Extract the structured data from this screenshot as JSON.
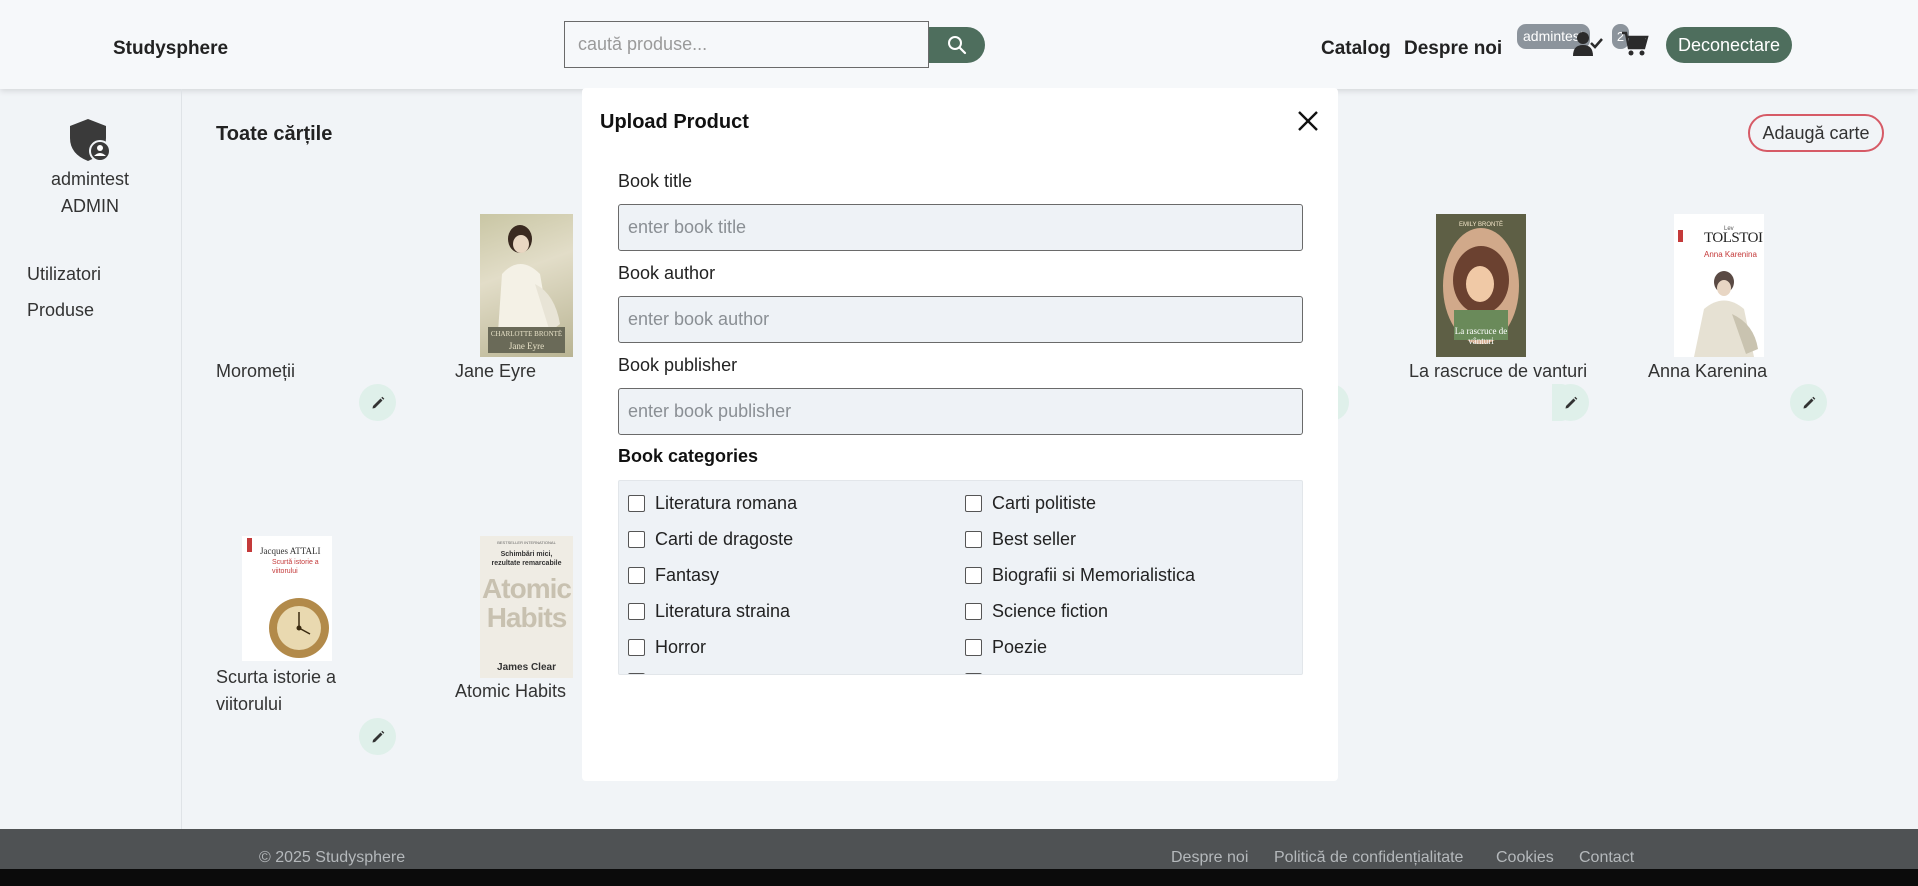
{
  "header": {
    "brand": "Studysphere",
    "search_placeholder": "caută produse...",
    "nav": {
      "catalog": "Catalog",
      "about": "Despre noi"
    },
    "user_badge": "admintest",
    "cart_count": "2",
    "logout": "Deconectare"
  },
  "sidebar": {
    "admin_name": "admintest",
    "admin_role": "ADMIN",
    "links": [
      "Utilizatori",
      "Produse"
    ]
  },
  "main": {
    "title": "Toate cărțile",
    "add_button": "Adaugă carte",
    "books": [
      {
        "title": "Moromeții"
      },
      {
        "title": "Jane Eyre"
      },
      {
        "title": "La rascruce de vanturi"
      },
      {
        "title": "Anna Karenina"
      },
      {
        "title": "Scurta istorie a viitorului"
      },
      {
        "title": "Atomic Habits"
      }
    ],
    "covers": {
      "jane_eyre_author": "CHARLOTTE BRONTË",
      "jane_eyre_title": "Jane Eyre",
      "rascruce_author": "EMILY BRONTË",
      "rascruce_title": "La rascruce de vânturi",
      "anna_author": "TOLSTOI",
      "anna_author_prefix": "Lev",
      "anna_title": "Anna Karenina",
      "attali_author": "Jacques ATTALI",
      "attali_title": "Scurtă istorie a viitorului",
      "atomic_tag": "BESTSELLER INTERNATIONAL",
      "atomic_subtitle": "Schimbări mici, rezultate remarcabile",
      "atomic_title": "Atomic Habits",
      "atomic_author": "James Clear"
    }
  },
  "modal": {
    "title": "Upload Product",
    "fields": [
      {
        "label": "Book title",
        "placeholder": "enter book title"
      },
      {
        "label": "Book author",
        "placeholder": "enter book author"
      },
      {
        "label": "Book publisher",
        "placeholder": "enter book publisher"
      }
    ],
    "categories_label": "Book categories",
    "categories": [
      "Literatura romana",
      "Carti politiste",
      "Carti de dragoste",
      "Best seller",
      "Fantasy",
      "Biografii si Memorialistica",
      "Literatura straina",
      "Science fiction",
      "Horror",
      "Poezie"
    ]
  },
  "footer": {
    "copyright": "© 2025 Studysphere",
    "links": [
      "Despre noi",
      "Politică de confidențialitate",
      "Cookies",
      "Contact"
    ]
  },
  "colors": {
    "primary": "#4e6e5d",
    "accent_border": "#d65a66",
    "badge": "#8c949c",
    "footer": "#4f5254"
  }
}
